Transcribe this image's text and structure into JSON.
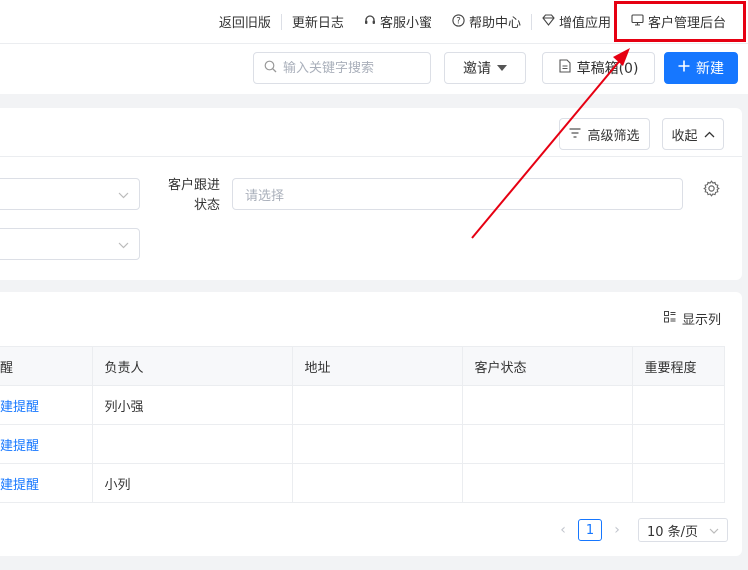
{
  "topbar": {
    "items": [
      {
        "label": "返回旧版"
      },
      {
        "label": "更新日志"
      },
      {
        "label": "客服小蜜",
        "icon": "headset-icon"
      },
      {
        "label": "帮助中心",
        "icon": "help-circle-icon"
      },
      {
        "label": "增值应用",
        "icon": "diamond-icon"
      },
      {
        "label": "客户管理后台",
        "icon": "monitor-icon"
      }
    ]
  },
  "toolbar": {
    "search_placeholder": "输入关键字搜索",
    "invite_label": "邀请",
    "drafts_label": "草稿箱(0)",
    "new_label": "新建"
  },
  "filters": {
    "advanced_label": "高级筛选",
    "collapse_label": "收起",
    "follow_status_label_line1": "客户跟进",
    "follow_status_label_line2": "状态",
    "follow_status_placeholder": "请选择"
  },
  "table": {
    "show_columns_label": "显示列",
    "headers": [
      "醒",
      "负责人",
      "地址",
      "客户状态",
      "重要程度"
    ],
    "rows": [
      [
        "建提醒",
        "列小强",
        "",
        "",
        ""
      ],
      [
        "建提醒",
        "",
        "",
        "",
        ""
      ],
      [
        "建提醒",
        "小列",
        "",
        "",
        ""
      ]
    ]
  },
  "pagination": {
    "current_page": "1",
    "page_size": "10 条/页"
  },
  "colors": {
    "primary": "#1677ff",
    "annotation_red": "#e60012"
  }
}
